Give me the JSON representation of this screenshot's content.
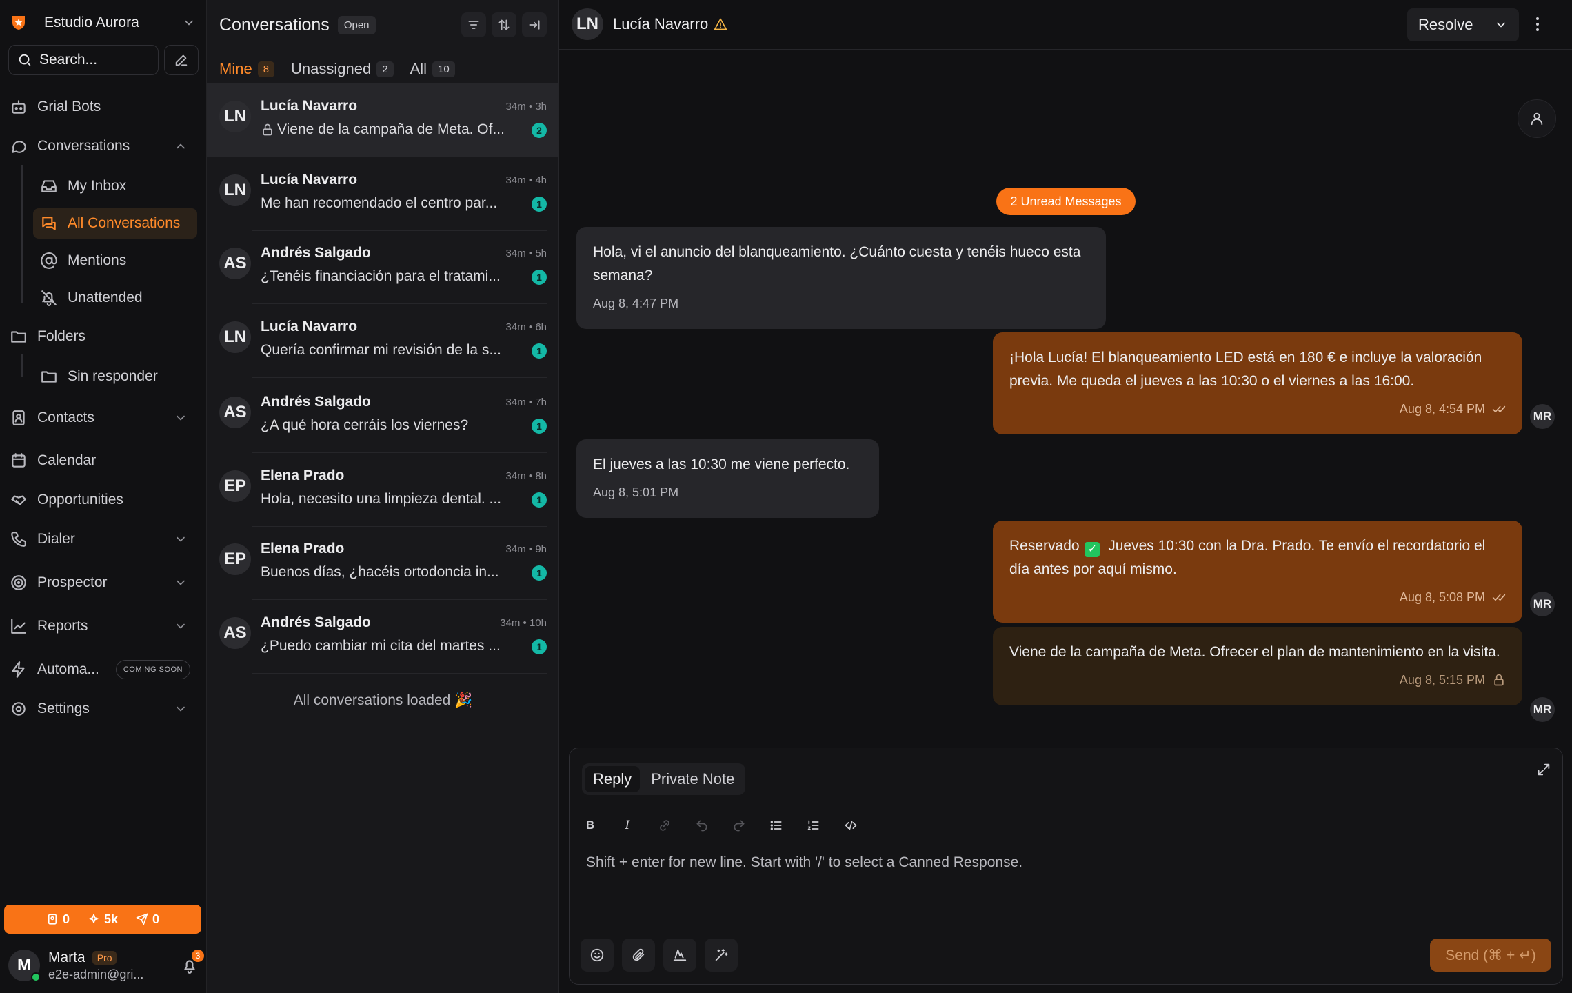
{
  "workspace": {
    "name": "Estudio Aurora"
  },
  "search": {
    "placeholder": "Search..."
  },
  "nav": {
    "bots": "Grial Bots",
    "conversations": "Conversations",
    "my_inbox": "My Inbox",
    "all_conversations": "All Conversations",
    "mentions": "Mentions",
    "unattended": "Unattended",
    "folders": "Folders",
    "sin_responder": "Sin responder",
    "contacts": "Contacts",
    "calendar": "Calendar",
    "opportunities": "Opportunities",
    "dialer": "Dialer",
    "prospector": "Prospector",
    "reports": "Reports",
    "automations": "Automa...",
    "coming_soon": "COMING SOON",
    "settings": "Settings"
  },
  "credits": {
    "contacts": "0",
    "ai": "5k",
    "sends": "0"
  },
  "user": {
    "name": "Marta",
    "initial": "M",
    "plan": "Pro",
    "email": "e2e-admin@gri...",
    "notifications": "3"
  },
  "list": {
    "title": "Conversations",
    "status": "Open",
    "tabs": [
      {
        "label": "Mine",
        "count": "8"
      },
      {
        "label": "Unassigned",
        "count": "2"
      },
      {
        "label": "All",
        "count": "10"
      }
    ],
    "items": [
      {
        "initials": "LN",
        "name": "Lucía Navarro",
        "time": "34m • 3h",
        "preview": "Viene de la campaña de Meta. Of...",
        "unread": "2"
      },
      {
        "initials": "LN",
        "name": "Lucía Navarro",
        "time": "34m • 4h",
        "preview": "Me han recomendado el centro par...",
        "unread": "1"
      },
      {
        "initials": "AS",
        "name": "Andrés Salgado",
        "time": "34m • 5h",
        "preview": "¿Tenéis financiación para el tratami...",
        "unread": "1"
      },
      {
        "initials": "LN",
        "name": "Lucía Navarro",
        "time": "34m • 6h",
        "preview": "Quería confirmar mi revisión de la s...",
        "unread": "1"
      },
      {
        "initials": "AS",
        "name": "Andrés Salgado",
        "time": "34m • 7h",
        "preview": "¿A qué hora cerráis los viernes?",
        "unread": "1"
      },
      {
        "initials": "EP",
        "name": "Elena Prado",
        "time": "34m • 8h",
        "preview": "Hola, necesito una limpieza dental. ...",
        "unread": "1"
      },
      {
        "initials": "EP",
        "name": "Elena Prado",
        "time": "34m • 9h",
        "preview": "Buenos días, ¿hacéis ortodoncia in...",
        "unread": "1"
      },
      {
        "initials": "AS",
        "name": "Andrés Salgado",
        "time": "34m • 10h",
        "preview": "¿Puedo cambiar mi cita del martes ...",
        "unread": "1"
      }
    ],
    "loaded": "All conversations loaded 🎉"
  },
  "chat": {
    "contact_initials": "LN",
    "contact_name": "Lucía Navarro",
    "resolve_label": "Resolve",
    "unread_pill": "2 Unread Messages",
    "messages": [
      {
        "text": "Hola, vi el anuncio del blanqueamiento. ¿Cuánto cuesta y tenéis hueco esta semana?",
        "time": "Aug 8, 4:47 PM"
      },
      {
        "text": "¡Hola Lucía! El blanqueamiento LED está en 180 € e incluye la valoración previa. Me queda el jueves a las 10:30 o el viernes a las 16:00.",
        "time": "Aug 8, 4:54 PM",
        "agent": "MR"
      },
      {
        "text": "El jueves a las 10:30 me viene perfecto.",
        "time": "Aug 8, 5:01 PM"
      },
      {
        "text_before": "Reservado",
        "emoji": "✓",
        "text_after": "Jueves 10:30 con la Dra. Prado. Te envío el recordatorio el día antes por aquí mismo.",
        "time": "Aug 8, 5:08 PM",
        "agent": "MR"
      },
      {
        "text": "Viene de la campaña de Meta. Ofrecer el plan de mantenimiento en la visita.",
        "time": "Aug 8, 5:15 PM",
        "agent": "MR"
      }
    ]
  },
  "composer": {
    "reply_label": "Reply",
    "note_label": "Private Note",
    "placeholder": "Shift + enter for new line. Start with '/' to select a Canned Response.",
    "send_label": "Send (⌘ + ↵)",
    "bold": "B",
    "italic": "I"
  }
}
